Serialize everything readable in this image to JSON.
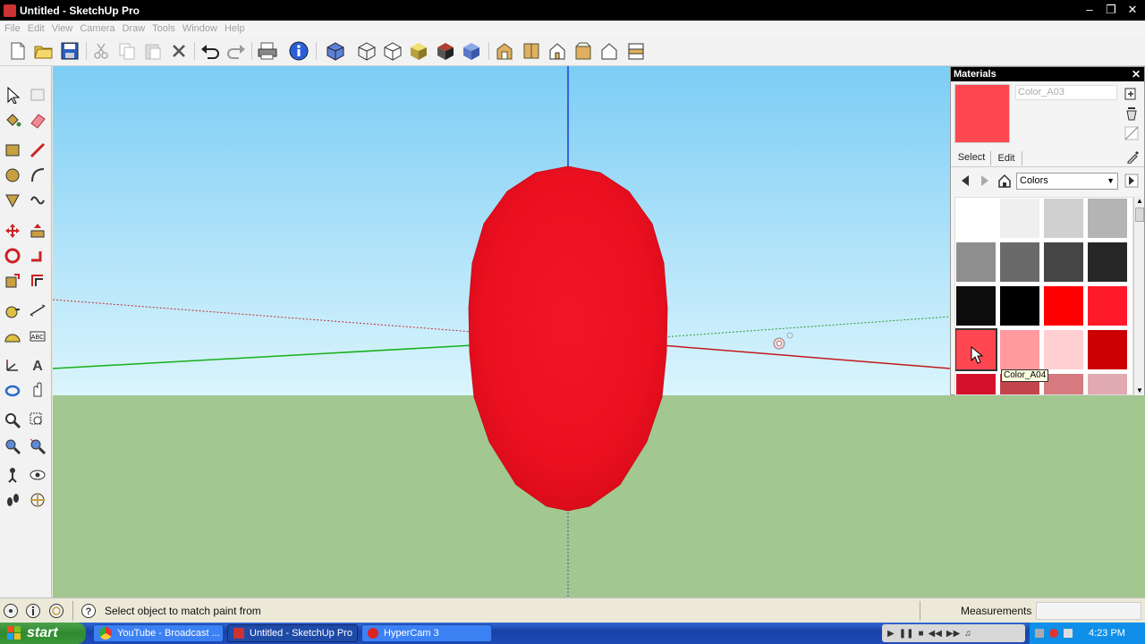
{
  "window": {
    "title": "Untitled - SketchUp Pro"
  },
  "menu": [
    "File",
    "Edit",
    "View",
    "Camera",
    "Draw",
    "Tools",
    "Window",
    "Help"
  ],
  "toolbar_icons": [
    "new-icon",
    "open-icon",
    "save-icon",
    "cut-icon",
    "copy-icon",
    "paste-icon",
    "erase-icon",
    "undo-icon",
    "redo-icon",
    "print-icon",
    "model-info-icon",
    "xray-icon",
    "wireframe-icon",
    "hidden-line-icon",
    "shaded-icon",
    "shaded-texture-icon",
    "iso-view-icon",
    "top-view-icon",
    "front-view-icon",
    "right-view-icon",
    "back-view-icon",
    "left-view-icon"
  ],
  "left_tools": [
    "select-icon",
    "make-component-icon",
    "paint-bucket-icon",
    "eraser-icon",
    "rectangle-icon",
    "line-icon",
    "circle-icon",
    "arc-icon",
    "polygon-icon",
    "freehand-icon",
    "move-icon",
    "push-pull-icon",
    "rotate-icon",
    "follow-me-icon",
    "scale-icon",
    "offset-icon",
    "tape-measure-icon",
    "dimension-icon",
    "protractor-icon",
    "text-icon",
    "axes-icon",
    "3d-text-icon",
    "orbit-icon",
    "pan-icon",
    "zoom-icon",
    "zoom-window-icon",
    "zoom-extents-icon",
    "previous-view-icon",
    "position-camera-icon",
    "look-around-icon",
    "walk-icon",
    "section-plane-icon"
  ],
  "materials": {
    "title": "Materials",
    "name_value": "Color_A03",
    "current_color": "#ff4751",
    "tab_select": "Select",
    "tab_edit": "Edit",
    "library": "Colors",
    "tooltip": "Color_A04",
    "swatches": [
      "#ffffff",
      "#efefef",
      "#d0d0d0",
      "#b4b4b4",
      "#8e8e8e",
      "#6a6a6a",
      "#454545",
      "#262626",
      "#0d0d0d",
      "#000000",
      "#ff0000",
      "#ff1a2a",
      "#ff4751",
      "#ff9a9e",
      "#ffcfd2",
      "#cc0000",
      "#d5102a",
      "#c4444c",
      "#d67a80",
      "#e0aab0"
    ]
  },
  "status": {
    "message": "Select object to match paint from",
    "measurements_label": "Measurements"
  },
  "taskbar": {
    "start": "start",
    "items": [
      "YouTube - Broadcast ...",
      "Untitled - SketchUp Pro",
      "HyperCam 3"
    ],
    "clock": "4:23 PM"
  },
  "colors": {
    "sky_top": "#82cff5",
    "sky_bottom": "#d9f4fd",
    "ground": "#a2c791",
    "shape": "#ee1020"
  }
}
